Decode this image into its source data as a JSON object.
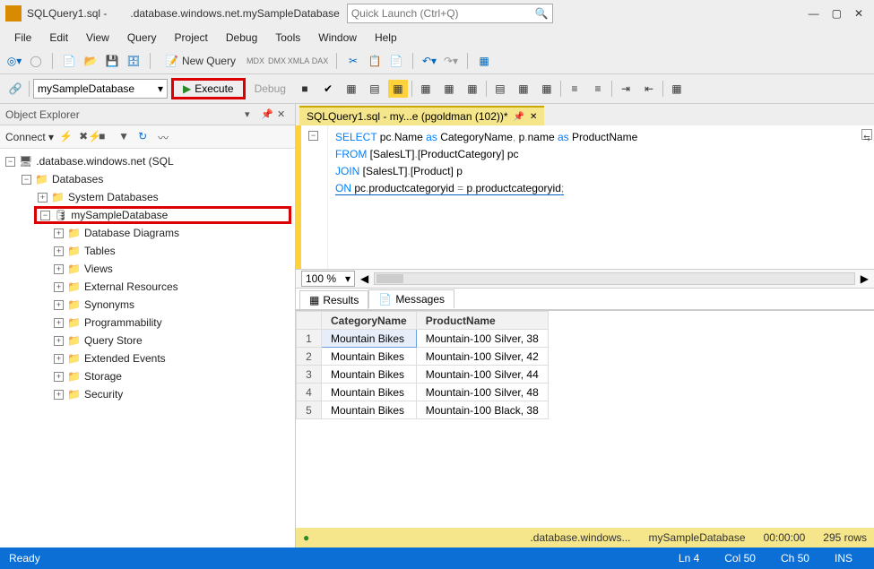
{
  "titlebar": {
    "file": "SQLQuery1.sql -",
    "server": ".database.windows.net.mySampleDatabase",
    "quickLaunch": "Quick Launch (Ctrl+Q)"
  },
  "menu": [
    "File",
    "Edit",
    "View",
    "Query",
    "Project",
    "Debug",
    "Tools",
    "Window",
    "Help"
  ],
  "toolbar": {
    "newQuery": "New Query"
  },
  "toolbar2": {
    "db": "mySampleDatabase",
    "execute": "Execute",
    "debug": "Debug"
  },
  "objectExplorer": {
    "title": "Object Explorer",
    "connect": "Connect",
    "server": ".database.windows.net (SQL",
    "databasesLabel": "Databases",
    "systemDb": "System Databases",
    "myDb": "mySampleDatabase",
    "children": [
      "Database Diagrams",
      "Tables",
      "Views",
      "External Resources",
      "Synonyms",
      "Programmability",
      "Query Store",
      "Extended Events",
      "Storage",
      "Security"
    ]
  },
  "tab": {
    "label": "SQLQuery1.sql - my...e (pgoldman (102))*"
  },
  "code": {
    "l1a": "SELECT",
    "l1b": " pc",
    "l1c": ".",
    "l1d": "Name ",
    "l1e": "as",
    "l1f": " CategoryName",
    "l1g": ",",
    "l1h": " p",
    "l1i": ".",
    "l1j": "name ",
    "l1k": "as",
    "l1l": " ProductName",
    "l2a": "FROM ",
    "l2b": "[SalesLT]",
    "l2c": ".",
    "l2d": "[ProductCategory]",
    "l2e": " pc",
    "l3a": "JOIN ",
    "l3b": "[SalesLT]",
    "l3c": ".",
    "l3d": "[Product]",
    "l3e": " p",
    "l4a": "ON ",
    "l4b": "pc",
    "l4c": ".",
    "l4d": "productcategoryid ",
    "l4e": "=",
    "l4f": " p",
    "l4g": ".",
    "l4h": "productcategoryid",
    "l4i": ";"
  },
  "zoom": "100 %",
  "results": {
    "resultsTab": "Results",
    "messagesTab": "Messages",
    "headers": {
      "c1": "CategoryName",
      "c2": "ProductName"
    },
    "rows": [
      {
        "n": "1",
        "c1": "Mountain Bikes",
        "c2": "Mountain-100 Silver, 38"
      },
      {
        "n": "2",
        "c1": "Mountain Bikes",
        "c2": "Mountain-100 Silver, 42"
      },
      {
        "n": "3",
        "c1": "Mountain Bikes",
        "c2": "Mountain-100 Silver, 44"
      },
      {
        "n": "4",
        "c1": "Mountain Bikes",
        "c2": "Mountain-100 Silver, 48"
      },
      {
        "n": "5",
        "c1": "Mountain Bikes",
        "c2": "Mountain-100 Black, 38"
      }
    ]
  },
  "yellowBar": {
    "server": ".database.windows...",
    "db": "mySampleDatabase",
    "time": "00:00:00",
    "rows": "295 rows"
  },
  "blueBar": {
    "ready": "Ready",
    "ln": "Ln 4",
    "col": "Col 50",
    "ch": "Ch 50",
    "ins": "INS"
  }
}
